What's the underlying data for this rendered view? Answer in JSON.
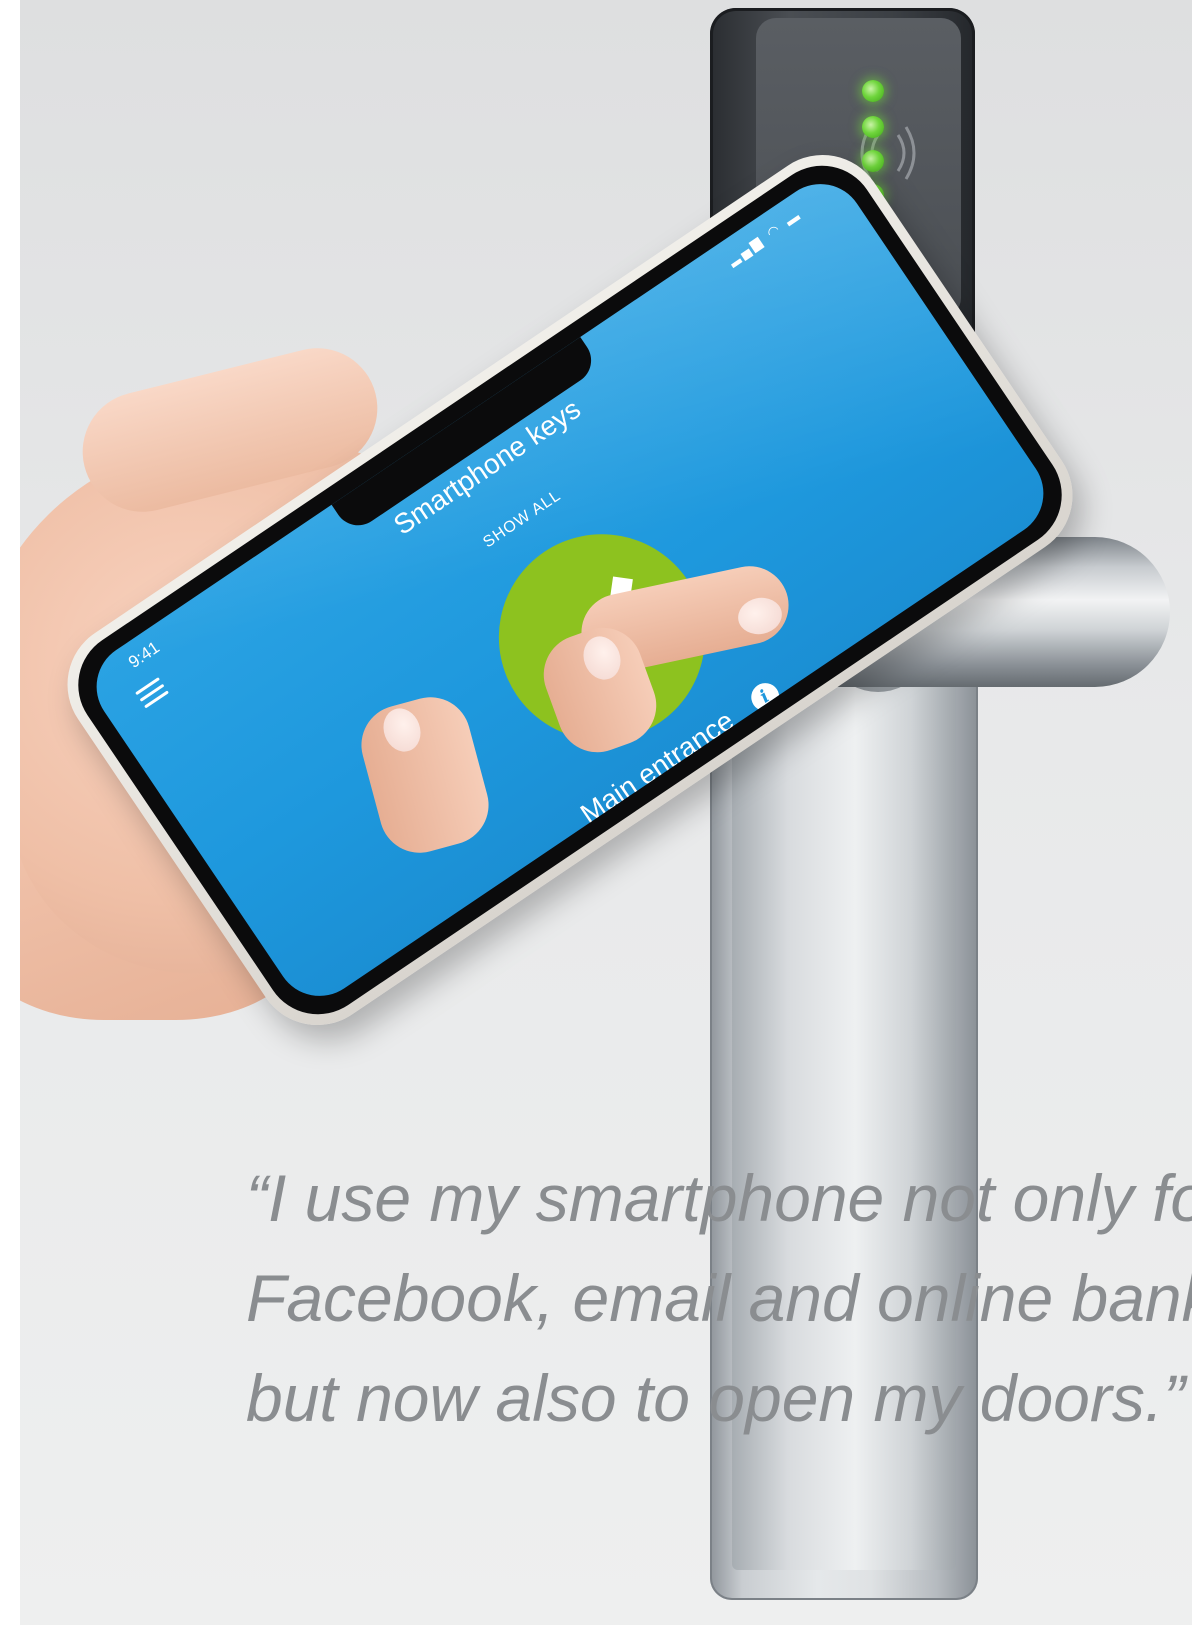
{
  "phone_app": {
    "status_time": "9:41",
    "status_icons": "signal-wifi-battery",
    "title": "Smartphone keys",
    "show_all_label": "SHOW ALL",
    "key_name": "Main entrance",
    "info_glyph": "i",
    "check_color": "#8dc21f",
    "screen_color": "#1e98dd"
  },
  "reader": {
    "led_color": "#6fd53c",
    "led_count": 4
  },
  "quote": {
    "lines": [
      "“I use my smartphone not only for",
      "Facebook, email and online banki",
      "but now also to open my doors.”"
    ]
  }
}
